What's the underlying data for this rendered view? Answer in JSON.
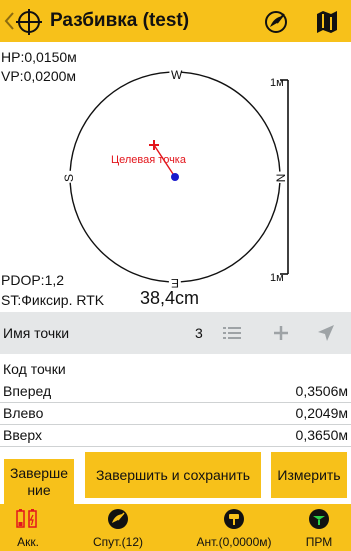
{
  "header": {
    "title": "Разбивка (test)",
    "accent_color": "#f7c11a",
    "icons": [
      "back-chevron-icon",
      "target-crosshair-icon",
      "satellite-dish-icon",
      "map-icon"
    ]
  },
  "survey": {
    "hp": "HP:0,0150м",
    "vp": "VP:0,0200м",
    "pdop": "PDOP:1,2",
    "status": "ST:Фиксир. RTK",
    "distance": "38,4cm",
    "target_label": "Целевая точка",
    "compass": {
      "north": "N",
      "south": "S",
      "east": "E",
      "west": "W"
    },
    "scale": {
      "top": "1м",
      "bottom": "1м"
    },
    "target_color": "#e3161c",
    "position_color": "#1a1acc"
  },
  "point": {
    "name_label": "Имя точки",
    "number": "3",
    "code_label": "Код точки"
  },
  "offsets": [
    {
      "label": "Вперед",
      "value": "0,3506м"
    },
    {
      "label": "Влево",
      "value": "0,2049м"
    },
    {
      "label": "Вверх",
      "value": "0,3650м"
    }
  ],
  "actions": {
    "finish": "Заверше\nние",
    "finish_save": "Завершить и сохранить",
    "measure": "Измерить"
  },
  "footer": [
    {
      "label": "Акк.",
      "icon": "battery-icon"
    },
    {
      "label": "Спут.(12)",
      "icon": "satellite-icon"
    },
    {
      "label": "Ант.(0,0000м)",
      "icon": "antenna-icon"
    },
    {
      "label": "ПРМ",
      "icon": "receiver-icon"
    }
  ]
}
